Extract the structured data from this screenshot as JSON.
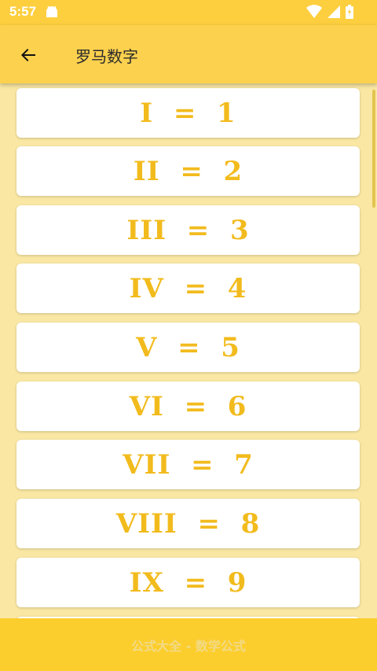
{
  "status_bar": {
    "time": "5:57"
  },
  "app_bar": {
    "title": "罗马数字",
    "back_icon": "arrow-left-icon"
  },
  "list": {
    "items": [
      "I  =  1",
      "II  =  2",
      "III  =  3",
      "IV  =  4",
      "V  =  5",
      "VI  =  6",
      "VII  =  7",
      "VIII  =  8",
      "IX  =  9"
    ]
  },
  "footer": {
    "text": "公式大全 - 数学公式"
  },
  "colors": {
    "accent": "#fcd14e",
    "numeral_text": "#f2bb1d",
    "background": "#f9e7a3"
  }
}
